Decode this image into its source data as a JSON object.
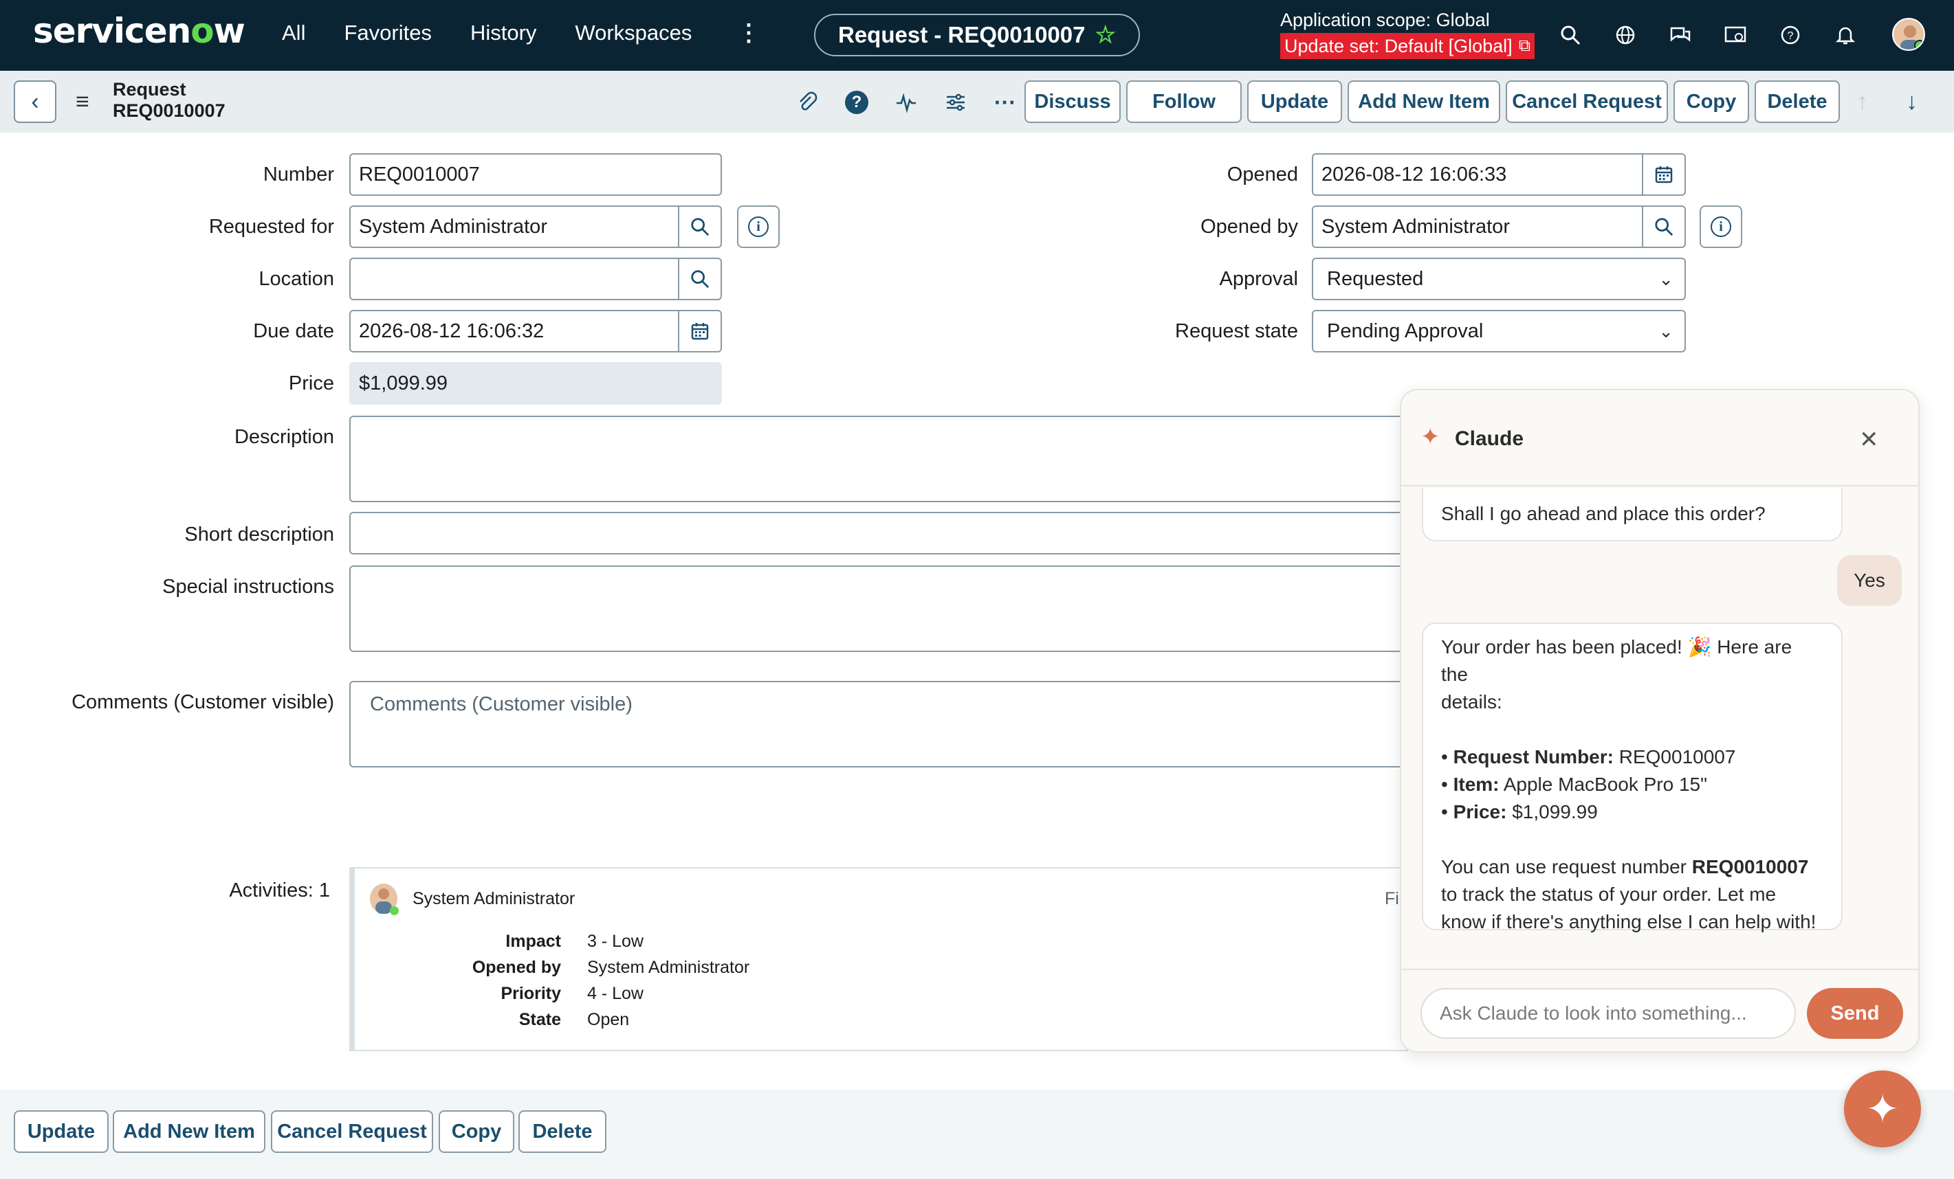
{
  "nav": {
    "logo_pre": "servicen",
    "logo_o": "o",
    "logo_post": "w",
    "links": [
      "All",
      "Favorites",
      "History",
      "Workspaces"
    ],
    "record_pill": "Request - REQ0010007",
    "app_scope": "Application scope: Global",
    "update_set": "Update set: Default [Global]"
  },
  "header": {
    "title_line1": "Request",
    "title_line2": "REQ0010007",
    "buttons": {
      "discuss": "Discuss",
      "follow": "Follow",
      "update": "Update",
      "add_new_item": "Add New Item",
      "cancel_request": "Cancel Request",
      "copy": "Copy",
      "delete": "Delete"
    }
  },
  "form": {
    "number": {
      "label": "Number",
      "value": "REQ0010007"
    },
    "requested_for": {
      "label": "Requested for",
      "value": "System Administrator"
    },
    "location": {
      "label": "Location",
      "value": ""
    },
    "due_date": {
      "label": "Due date",
      "value": "2026-08-12 16:06:32"
    },
    "price": {
      "label": "Price",
      "value": "$1,099.99"
    },
    "opened": {
      "label": "Opened",
      "value": "2026-08-12 16:06:33"
    },
    "opened_by": {
      "label": "Opened by",
      "value": "System Administrator"
    },
    "approval": {
      "label": "Approval",
      "value": "Requested"
    },
    "request_state": {
      "label": "Request state",
      "value": "Pending Approval"
    },
    "description": {
      "label": "Description"
    },
    "short_description": {
      "label": "Short description"
    },
    "special_instructions": {
      "label": "Special instructions"
    },
    "comments": {
      "label": "Comments (Customer visible)",
      "placeholder": "Comments (Customer visible)"
    }
  },
  "activity": {
    "label": "Activities: 1",
    "user": "System Administrator",
    "truncated": "Fie",
    "rows": [
      {
        "k": "Impact",
        "v": "3 - Low"
      },
      {
        "k": "Opened by",
        "v": "System Administrator"
      },
      {
        "k": "Priority",
        "v": "4 - Low"
      },
      {
        "k": "State",
        "v": "Open"
      }
    ]
  },
  "footer_buttons": {
    "update": "Update",
    "add_new_item": "Add New Item",
    "cancel_request": "Cancel Request",
    "copy": "Copy",
    "delete": "Delete"
  },
  "claude": {
    "title": "Claude",
    "partial_text": "Shall I go ahead and place this order?",
    "user_msg": "Yes",
    "reply": {
      "intro_1": "Your order has been placed! 🎉 Here are the",
      "intro_2": "details:",
      "req_label": "Request Number:",
      "req_value": " REQ0010007",
      "item_label": "Item:",
      "item_value": " Apple MacBook Pro 15\"",
      "price_label": "Price:",
      "price_value": " $1,099.99",
      "outro_1a": "You can use request number ",
      "outro_1b": "REQ0010007",
      "outro_2": "to track the status of your order. Let me",
      "outro_3": "know if there's anything else I can help with!"
    },
    "input_placeholder": "Ask Claude to look into something...",
    "send": "Send"
  },
  "colors": {
    "nav_bg": "#0b2433",
    "accent_green": "#62d84e",
    "update_set_red": "#e3222d",
    "button_text": "#1a4e6e",
    "claude_accent": "#d9704e"
  }
}
